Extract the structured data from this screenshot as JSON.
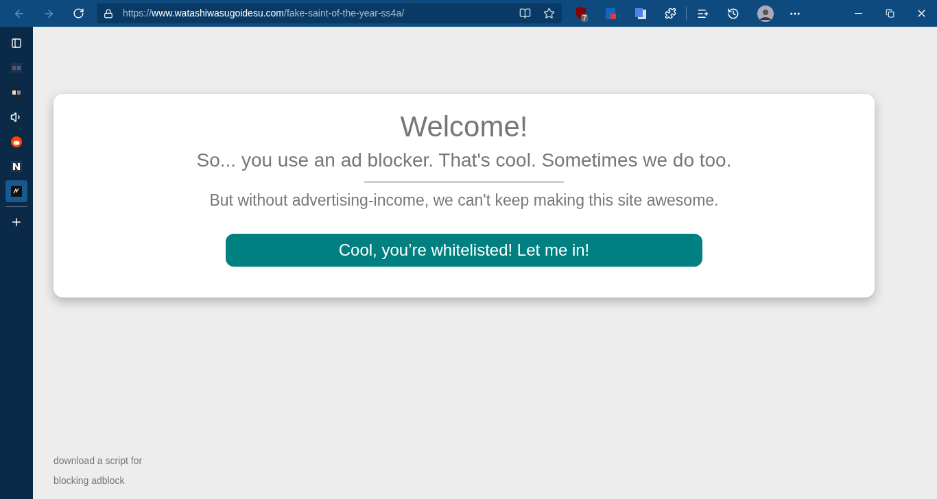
{
  "toolbar": {
    "url_scheme": "https://",
    "url_domain": "www.watashiwasugoidesu.com",
    "url_path": "/fake-saint-of-the-year-ss4a/",
    "extension_badge": "7"
  },
  "sidebar": {
    "items": [
      {
        "kind": "panel",
        "selected": false
      },
      {
        "kind": "ms-dim",
        "selected": false
      },
      {
        "kind": "ms",
        "selected": false
      },
      {
        "kind": "speaker",
        "selected": false
      },
      {
        "kind": "reddit",
        "selected": false
      },
      {
        "kind": "n",
        "selected": false
      },
      {
        "kind": "pen",
        "selected": true
      }
    ]
  },
  "dialog": {
    "title": "Welcome!",
    "subtitle": "So... you use an ad blocker. That's cool. Sometimes we do too.",
    "message": "But without advertising-income, we can't keep making this site awesome.",
    "button": "Cool, you’re whitelisted! Let me in!"
  },
  "footer_links": [
    "download a script for",
    "blocking adblock"
  ]
}
